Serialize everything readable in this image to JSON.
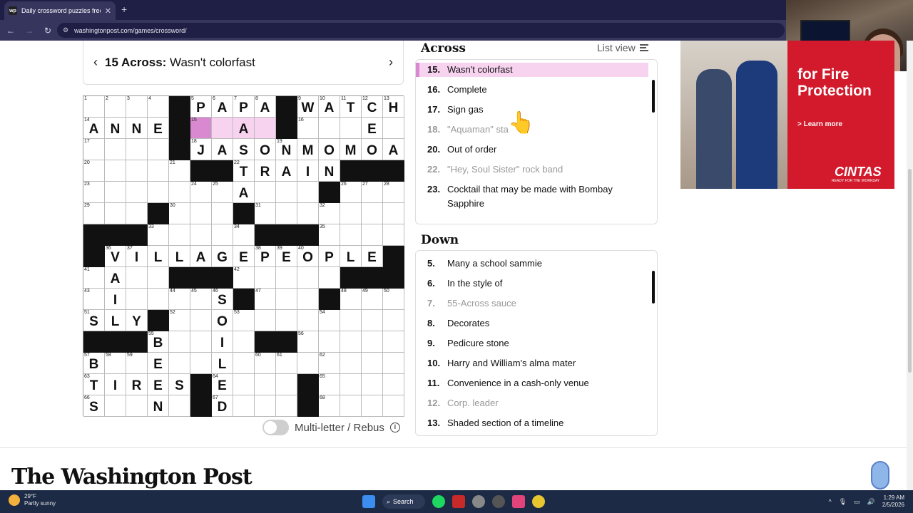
{
  "browser": {
    "tab_title": "Daily crossword puzzles free fr",
    "favicon_text": "wp",
    "url": "washingtonpost.com/games/crossword/",
    "icons": [
      "back-icon",
      "forward-icon",
      "reload-icon",
      "site-info-icon",
      "close-icon",
      "plus-icon"
    ]
  },
  "clue_bar": {
    "label": "15 Across:",
    "text": "Wasn't colorfast"
  },
  "grid": {
    "size": 15,
    "rows": [
      {
        "cells": [
          {
            "n": "1"
          },
          {
            "n": "2"
          },
          {
            "n": "3"
          },
          {
            "n": "4"
          },
          {
            "b": 1
          },
          {
            "n": "5",
            "l": "P"
          },
          {
            "n": "6",
            "l": "A"
          },
          {
            "n": "7",
            "l": "P"
          },
          {
            "n": "8",
            "l": "A"
          },
          {
            "b": 1
          },
          {
            "n": "9",
            "l": "W"
          },
          {
            "n": "10",
            "l": "A"
          },
          {
            "n": "11",
            "l": "T"
          },
          {
            "n": "12",
            "l": "C"
          },
          {
            "n": "13",
            "l": "H"
          }
        ]
      },
      {
        "cells": [
          {
            "n": "14",
            "l": "A"
          },
          {
            "l": "N"
          },
          {
            "l": "N"
          },
          {
            "l": "E"
          },
          {
            "b": 1
          },
          {
            "n": "15",
            "s": "sel"
          },
          {
            "s": "hl"
          },
          {
            "s": "hl",
            "l": "A"
          },
          {
            "s": "hl"
          },
          {
            "b": 1
          },
          {
            "n": "16"
          },
          {},
          {},
          {
            "l": "E"
          },
          {}
        ]
      },
      {
        "cells": [
          {
            "n": "17"
          },
          {},
          {},
          {},
          {
            "b": 1
          },
          {
            "n": "18",
            "l": "J"
          },
          {
            "l": "A"
          },
          {
            "l": "S"
          },
          {
            "l": "O"
          },
          {
            "n": "19",
            "l": "N"
          },
          {
            "l": "M"
          },
          {
            "l": "O"
          },
          {
            "l": "M"
          },
          {
            "l": "O"
          },
          {
            "l": "A"
          }
        ]
      },
      {
        "cells": [
          {
            "n": "20"
          },
          {},
          {},
          {},
          {
            "n": "21"
          },
          {
            "b": 1
          },
          {
            "b": 1
          },
          {
            "n": "22",
            "l": "T"
          },
          {
            "l": "R"
          },
          {
            "l": "A"
          },
          {
            "l": "I"
          },
          {
            "l": "N"
          },
          {
            "b": 1
          },
          {
            "b": 1
          },
          {
            "b": 1
          }
        ]
      },
      {
        "cells": [
          {
            "n": "23"
          },
          {},
          {},
          {},
          {},
          {
            "n": "24"
          },
          {
            "n": "25"
          },
          {
            "l": "A"
          },
          {},
          {},
          {},
          {
            "b": 1
          },
          {
            "n": "26"
          },
          {
            "n": "27"
          },
          {
            "n": "28"
          }
        ]
      },
      {
        "cells": [
          {
            "n": "29"
          },
          {},
          {},
          {
            "b": 1
          },
          {
            "n": "30"
          },
          {},
          {},
          {
            "b": 1
          },
          {
            "n": "31"
          },
          {},
          {},
          {
            "n": "32"
          },
          {},
          {},
          {}
        ]
      },
      {
        "cells": [
          {
            "b": 1
          },
          {
            "b": 1
          },
          {
            "b": 1
          },
          {
            "n": "33"
          },
          {},
          {},
          {},
          {
            "n": "34"
          },
          {
            "b": 1
          },
          {
            "b": 1
          },
          {
            "b": 1
          },
          {
            "n": "35"
          },
          {},
          {},
          {}
        ]
      },
      {
        "cells": [
          {
            "b": 1
          },
          {
            "n": "36",
            "l": "V"
          },
          {
            "n": "37",
            "l": "I"
          },
          {
            "l": "L"
          },
          {
            "l": "L"
          },
          {
            "l": "A"
          },
          {
            "l": "G"
          },
          {
            "l": "E"
          },
          {
            "n": "38",
            "l": "P"
          },
          {
            "n": "39",
            "l": "E"
          },
          {
            "n": "40",
            "l": "O"
          },
          {
            "l": "P"
          },
          {
            "l": "L"
          },
          {
            "l": "E"
          },
          {
            "b": 1
          }
        ]
      },
      {
        "cells": [
          {
            "n": "41"
          },
          {
            "l": "A"
          },
          {},
          {},
          {
            "b": 1
          },
          {
            "b": 1
          },
          {
            "b": 1
          },
          {
            "n": "42"
          },
          {},
          {},
          {},
          {},
          {
            "b": 1
          },
          {
            "b": 1
          },
          {
            "b": 1
          }
        ]
      },
      {
        "cells": [
          {
            "n": "43"
          },
          {
            "l": "I"
          },
          {},
          {},
          {
            "n": "44"
          },
          {
            "n": "45"
          },
          {
            "n": "46",
            "l": "S"
          },
          {
            "b": 1
          },
          {
            "n": "47"
          },
          {},
          {},
          {
            "b": 1
          },
          {
            "n": "48"
          },
          {
            "n": "49"
          },
          {
            "n": "50"
          }
        ]
      },
      {
        "cells": [
          {
            "n": "51",
            "l": "S"
          },
          {
            "l": "L"
          },
          {
            "l": "Y"
          },
          {
            "b": 1
          },
          {
            "n": "52"
          },
          {},
          {
            "l": "O"
          },
          {
            "n": "53"
          },
          {},
          {},
          {},
          {
            "n": "54"
          },
          {},
          {},
          {}
        ]
      },
      {
        "cells": [
          {
            "b": 1
          },
          {
            "b": 1
          },
          {
            "b": 1
          },
          {
            "n": "55",
            "l": "B"
          },
          {},
          {},
          {
            "l": "I"
          },
          {},
          {
            "b": 1
          },
          {
            "b": 1
          },
          {
            "n": "56"
          },
          {},
          {},
          {},
          {}
        ]
      },
      {
        "cells": [
          {
            "n": "57",
            "l": "B"
          },
          {
            "n": "58"
          },
          {
            "n": "59"
          },
          {
            "l": "E"
          },
          {},
          {},
          {
            "l": "L"
          },
          {},
          {
            "n": "60"
          },
          {
            "n": "61"
          },
          {},
          {
            "n": "62"
          },
          {},
          {},
          {}
        ]
      },
      {
        "cells": [
          {
            "n": "63",
            "l": "T"
          },
          {
            "l": "I"
          },
          {
            "l": "R"
          },
          {
            "l": "E"
          },
          {
            "l": "S"
          },
          {
            "b": 1
          },
          {
            "n": "64",
            "l": "E"
          },
          {},
          {},
          {},
          {
            "b": 1
          },
          {
            "n": "65"
          },
          {},
          {},
          {}
        ]
      },
      {
        "cells": [
          {
            "n": "66",
            "l": "S"
          },
          {},
          {},
          {
            "l": "N"
          },
          {},
          {
            "b": 1
          },
          {
            "n": "67",
            "l": "D"
          },
          {},
          {},
          {},
          {
            "b": 1
          },
          {
            "n": "68"
          },
          {},
          {},
          {}
        ]
      }
    ]
  },
  "rebus": {
    "label": "Multi-letter / Rebus"
  },
  "across": {
    "heading": "Across",
    "list_view_label": "List view",
    "clues": [
      {
        "num": "15.",
        "text": "Wasn't colorfast",
        "state": "active"
      },
      {
        "num": "16.",
        "text": "Complete",
        "state": ""
      },
      {
        "num": "17.",
        "text": "Sign gas",
        "state": ""
      },
      {
        "num": "18.",
        "text": "\"Aquaman\" sta",
        "state": "done"
      },
      {
        "num": "20.",
        "text": "Out of order",
        "state": ""
      },
      {
        "num": "22.",
        "text": "\"Hey, Soul Sister\" rock band",
        "state": "done"
      },
      {
        "num": "23.",
        "text": "Cocktail that may be made with Bombay Sapphire",
        "state": ""
      }
    ]
  },
  "down": {
    "heading": "Down",
    "clues": [
      {
        "num": "5.",
        "text": "Many a school sammie",
        "state": ""
      },
      {
        "num": "6.",
        "text": "In the style of",
        "state": ""
      },
      {
        "num": "7.",
        "text": "55-Across sauce",
        "state": "done"
      },
      {
        "num": "8.",
        "text": "Decorates",
        "state": ""
      },
      {
        "num": "9.",
        "text": "Pedicure stone",
        "state": ""
      },
      {
        "num": "10.",
        "text": "Harry and William's alma mater",
        "state": ""
      },
      {
        "num": "11.",
        "text": "Convenience in a cash-only venue",
        "state": ""
      },
      {
        "num": "12.",
        "text": "Corp. leader",
        "state": "done"
      },
      {
        "num": "13.",
        "text": "Shaded section of a timeline",
        "state": ""
      }
    ]
  },
  "ad": {
    "headline": "for Fire Protection",
    "cta": "> Learn more",
    "brand": "CINTAS",
    "tagline": "READY FOR THE WORKDAY"
  },
  "footer": {
    "logo": "The Washington Post"
  },
  "taskbar": {
    "temperature": "29°F",
    "condition": "Partly sunny",
    "search_label": "Search",
    "time": "1:29 AM",
    "date": "2/5/2026"
  }
}
